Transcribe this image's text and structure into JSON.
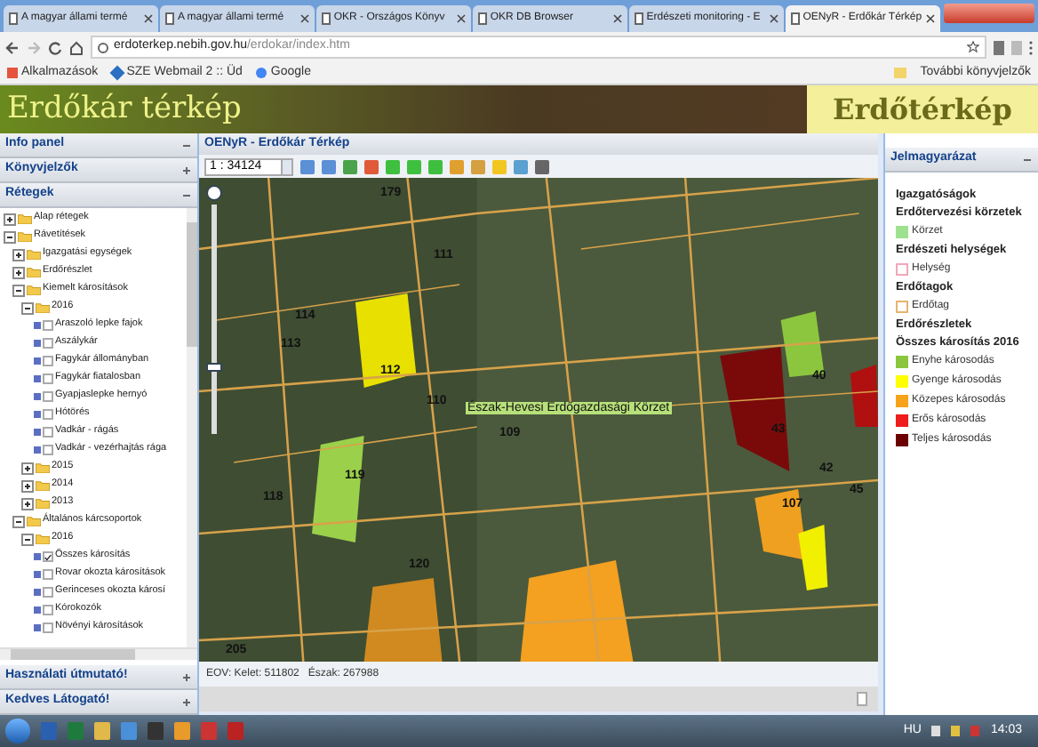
{
  "browser": {
    "tabs": [
      {
        "title": "A magyar állami termé",
        "selected": false
      },
      {
        "title": "A magyar állami termé",
        "selected": false
      },
      {
        "title": "OKR - Országos Könyv",
        "selected": false
      },
      {
        "title": "OKR DB Browser",
        "selected": false
      },
      {
        "title": "Erdészeti monitoring - E",
        "selected": false
      },
      {
        "title": "OENyR - Erdőkár Térkép",
        "selected": true
      }
    ],
    "address": {
      "host": "erdoterkep.nebih.gov.hu",
      "path": "/erdokar/index.htm"
    },
    "bookmarks": [
      "Alkalmazások",
      "SZE Webmail 2 :: Üd",
      "Google"
    ],
    "other_bookmarks": "További könyvjelzők"
  },
  "banner": {
    "title": "Erdőkár térkép",
    "logo": "Erdőtérkép"
  },
  "left_panel": {
    "sections_top": [
      "Info panel",
      "Könyvjelzők",
      "Rétegek"
    ],
    "tree": [
      {
        "kind": "folder",
        "label": "Alap rétegek",
        "expanded": false
      },
      {
        "kind": "folder",
        "label": "Rávetítések",
        "expanded": true,
        "children": [
          {
            "kind": "folder",
            "label": "Igazgatási egységek",
            "expanded": false
          },
          {
            "kind": "folder",
            "label": "Erdőrészlet",
            "expanded": false
          },
          {
            "kind": "folder",
            "label": "Kiemelt károsítások",
            "expanded": true,
            "children": [
              {
                "kind": "folder",
                "label": "2016",
                "expanded": true,
                "children": [
                  {
                    "kind": "layer",
                    "label": "Araszoló lepke fajok",
                    "checked": false
                  },
                  {
                    "kind": "layer",
                    "label": "Aszálykár",
                    "checked": false
                  },
                  {
                    "kind": "layer",
                    "label": "Fagykár állományban",
                    "checked": false
                  },
                  {
                    "kind": "layer",
                    "label": "Fagykár fiatalosban",
                    "checked": false
                  },
                  {
                    "kind": "layer",
                    "label": "Gyapjaslepke hernyó",
                    "checked": false
                  },
                  {
                    "kind": "layer",
                    "label": "Hótörés",
                    "checked": false
                  },
                  {
                    "kind": "layer",
                    "label": "Vadkár - rágás",
                    "checked": false
                  },
                  {
                    "kind": "layer",
                    "label": "Vadkár - vezérhajtás rága",
                    "checked": false
                  }
                ]
              },
              {
                "kind": "folder",
                "label": "2015",
                "expanded": false
              },
              {
                "kind": "folder",
                "label": "2014",
                "expanded": false
              },
              {
                "kind": "folder",
                "label": "2013",
                "expanded": false
              }
            ]
          },
          {
            "kind": "folder",
            "label": "Általános kárcsoportok",
            "expanded": true,
            "children": [
              {
                "kind": "folder",
                "label": "2016",
                "expanded": true,
                "children": [
                  {
                    "kind": "layer",
                    "label": "Összes károsítás",
                    "checked": true
                  },
                  {
                    "kind": "layer",
                    "label": "Rovar okozta károsítások",
                    "checked": false
                  },
                  {
                    "kind": "layer",
                    "label": "Gerinceses okozta károsí",
                    "checked": false
                  },
                  {
                    "kind": "layer",
                    "label": "Kórokozók",
                    "checked": false
                  },
                  {
                    "kind": "layer",
                    "label": "Növényi károsítások",
                    "checked": false
                  }
                ]
              }
            ]
          }
        ]
      }
    ],
    "sections_bottom": [
      "Használati útmutató!",
      "Kedves Látogató!"
    ]
  },
  "map_panel": {
    "title": "OENyR - Erdőkár Térkép",
    "scale": "1 : 34124",
    "parcel_labels": [
      "179",
      "111",
      "114",
      "113",
      "112",
      "110",
      "109",
      "118",
      "119",
      "120",
      "205",
      "40",
      "43",
      "42",
      "45",
      "107"
    ],
    "region_label": "Észak-Hevesi Erdőgazdasági Körzet",
    "coordinates": "EOV: Kelet: 511802   Észak: 267988"
  },
  "legend": {
    "title": "Jelmagyarázat",
    "items": [
      {
        "kind": "heading",
        "label": "Igazgatóságok"
      },
      {
        "kind": "heading",
        "label": "Erdőtervezési körzetek"
      },
      {
        "kind": "fill",
        "label": "Körzet",
        "color": "#9ee28f"
      },
      {
        "kind": "heading",
        "label": "Erdészeti helységek"
      },
      {
        "kind": "outline",
        "label": "Helység",
        "color": "#f2a7b8"
      },
      {
        "kind": "heading",
        "label": "Erdőtagok"
      },
      {
        "kind": "outline",
        "label": "Erdőtag",
        "color": "#e6b46e"
      },
      {
        "kind": "heading",
        "label": "Erdőrészletek"
      },
      {
        "kind": "heading",
        "label": "Összes károsítás 2016"
      },
      {
        "kind": "fill",
        "label": "Enyhe károsodás",
        "color": "#8cc63f"
      },
      {
        "kind": "fill",
        "label": "Gyenge károsodás",
        "color": "#ffff00"
      },
      {
        "kind": "fill",
        "label": "Közepes károsodás",
        "color": "#f7a21b"
      },
      {
        "kind": "fill",
        "label": "Erős károsodás",
        "color": "#ee1c1c"
      },
      {
        "kind": "fill",
        "label": "Teljes károsodás",
        "color": "#6b0000"
      }
    ]
  },
  "taskbar": {
    "language": "HU",
    "time": "14:03"
  }
}
